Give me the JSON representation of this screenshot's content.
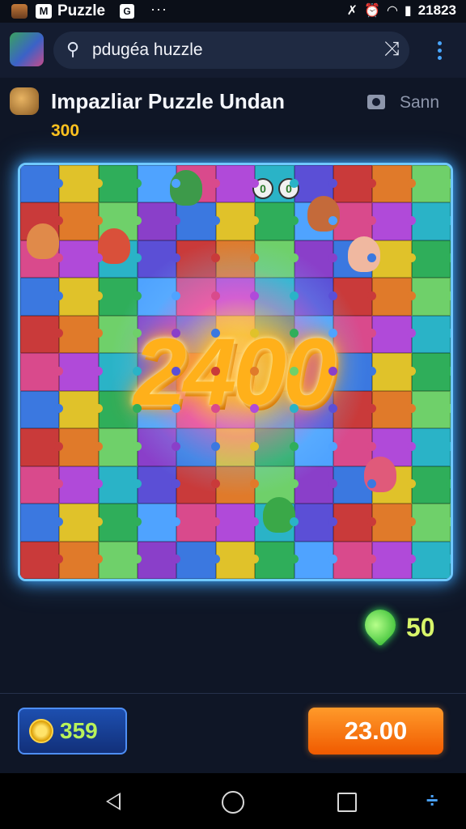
{
  "status_bar": {
    "app_name": "Puzzle",
    "msg_icon_glyph": "M",
    "small_icon_glyph": "G",
    "overflow": "···",
    "time": "21823"
  },
  "header": {
    "search_text": "pdugéa huzzle",
    "search_icon": "search-icon",
    "shuffle_icon": "shuffle-icon",
    "menu_icon": "more-vert-icon"
  },
  "game": {
    "title": "Impazliar Puzzle Undan",
    "score": "300",
    "scan_label": "Sann",
    "combo_badges": [
      "0",
      "0"
    ]
  },
  "board": {
    "burst_number": "2400",
    "bonus_value": "50"
  },
  "footer": {
    "coins": "359",
    "price": "23.00"
  },
  "colors": {
    "accent_blue": "#4aa3ff",
    "gold": "#ffc21f",
    "buy_orange": "#f46b0a",
    "bonus_green": "#d8f56a"
  }
}
